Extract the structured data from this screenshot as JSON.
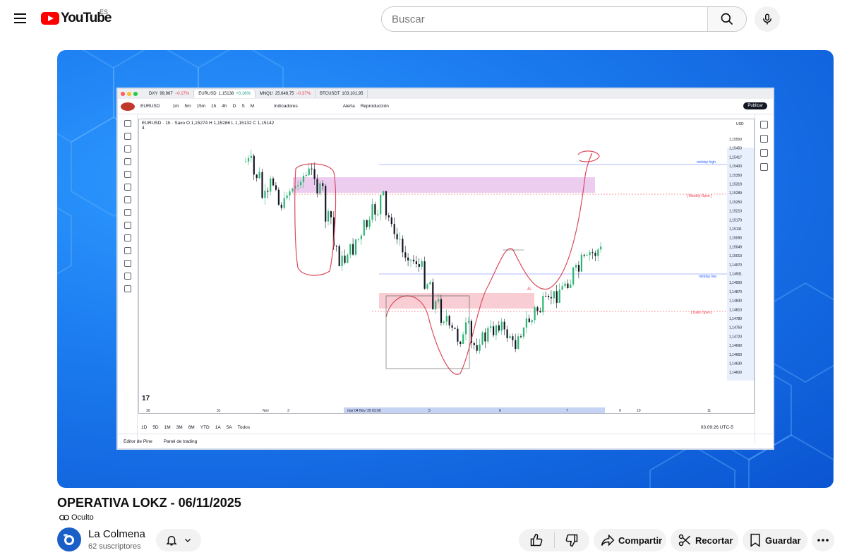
{
  "masthead": {
    "logo_text": "YouTube",
    "country_code": "ES",
    "search_placeholder": "Buscar",
    "icons": [
      "menu-icon",
      "youtube-logo",
      "search-icon",
      "microphone-icon"
    ]
  },
  "video": {
    "title": "OPERATIVA LOKZ - 06/11/2025",
    "privacy_label": "Oculto",
    "privacy_icon": "link-icon"
  },
  "channel": {
    "name": "La Colmena",
    "subscribers": "62 suscriptores"
  },
  "actions": {
    "share_label": "Compartir",
    "clip_label": "Recortar",
    "save_label": "Guardar"
  },
  "tradingview": {
    "tabs": [
      {
        "symbol": "DXY",
        "price": "99,967",
        "change": "−0.17%"
      },
      {
        "symbol": "EURUSD",
        "price": "1,15138",
        "change": "+0.16%"
      },
      {
        "symbol": "MNQ1!",
        "price": "25.648,75",
        "change": "−0.37%"
      },
      {
        "symbol": "BTCUSDT",
        "price": "103.101,95",
        "change": ""
      }
    ],
    "toolbar": {
      "symbol": "EURUSD",
      "timeframes": [
        "1m",
        "5m",
        "15m",
        "1h",
        "4h",
        "D",
        "S",
        "M"
      ],
      "indicators": "Indicadores",
      "alert": "Alerta",
      "replay": "Reproducción",
      "publish": "Publicar"
    },
    "legend": {
      "symbol": "EURUSD · 1h · Saxo",
      "ohlc": "O 1,15274  H 1,15286  L 1,15132  C 1,15142",
      "count": "4"
    },
    "drawing_toolbar": {
      "stroke": "2px"
    },
    "price_axis": {
      "currency": "USD",
      "labels": [
        "1,15500",
        "1,15450",
        "1,15417",
        "1,15400",
        "1,15350",
        "1,15319",
        "1,15289",
        "1,15250",
        "1,15210",
        "1,15170",
        "1,15131",
        "1,15090",
        "1,15049",
        "1,15010",
        "1,14970",
        "1,14931",
        "1,14900",
        "1,14870",
        "1,14840",
        "1,14810",
        "1,14780",
        "1,14750",
        "1,14720",
        "1,14690",
        "1,14660",
        "1,14630",
        "1,14600"
      ]
    },
    "level_labels": {
      "midday_high": "midday high",
      "weekly_open": "[ Weekly Open ]",
      "midday_low": "midday low",
      "daily_open": "[ Daily Open ]",
      "marker": "AL"
    },
    "time_axis": [
      "30",
      "31",
      "Nov",
      "3",
      "mar 04 Nov '25  03:00",
      "5",
      "6",
      "7",
      "9",
      "10",
      "11"
    ],
    "ranges": [
      "1D",
      "5D",
      "1M",
      "3M",
      "6M",
      "YTD",
      "1A",
      "5A",
      "Todos"
    ],
    "clock": "03:09:26 UTC-5",
    "footer_tabs": [
      "Editor de Pine",
      "Panel de trading"
    ]
  }
}
